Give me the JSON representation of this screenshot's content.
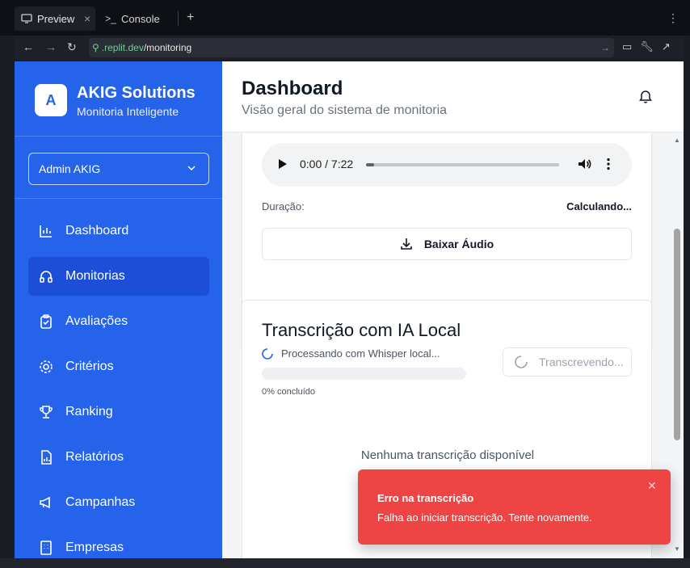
{
  "browser": {
    "tabs": [
      {
        "label": "Preview",
        "icon": "monitor-icon"
      },
      {
        "label": "Console",
        "icon": "terminal-icon"
      }
    ],
    "url_host": ".replit.dev",
    "url_path": "/monitoring"
  },
  "sidebar": {
    "logo_letter": "A",
    "brand_name": "AKIG Solutions",
    "brand_sub": "Monitoria Inteligente",
    "user": "Admin AKIG",
    "items": [
      {
        "label": "Dashboard",
        "icon": "bar-chart-icon"
      },
      {
        "label": "Monitorias",
        "icon": "headphones-icon"
      },
      {
        "label": "Avaliações",
        "icon": "clipboard-check-icon"
      },
      {
        "label": "Critérios",
        "icon": "gear-icon"
      },
      {
        "label": "Ranking",
        "icon": "trophy-icon"
      },
      {
        "label": "Relatórios",
        "icon": "report-icon"
      },
      {
        "label": "Campanhas",
        "icon": "megaphone-icon"
      },
      {
        "label": "Empresas",
        "icon": "building-icon"
      }
    ],
    "active_index": 1
  },
  "header": {
    "title": "Dashboard",
    "subtitle": "Visão geral do sistema de monitoria"
  },
  "audio": {
    "time": "0:00 / 7:22",
    "duration_label": "Duração:",
    "duration_value": "Calculando...",
    "download_label": "Baixar Áudio"
  },
  "transcription": {
    "title": "Transcrição com IA Local",
    "processing": "Processando com Whisper local...",
    "progress_text": "0% concluído",
    "progress": 0,
    "button_label": "Transcrevendo...",
    "empty": "Nenhuma transcrição disponível"
  },
  "toast": {
    "title": "Erro na transcrição",
    "message": "Falha ao iniciar transcrição. Tente novamente.",
    "color": "#ef4444"
  },
  "colors": {
    "sidebar": "#2563eb",
    "sidebar_active": "#1d4ed8"
  }
}
